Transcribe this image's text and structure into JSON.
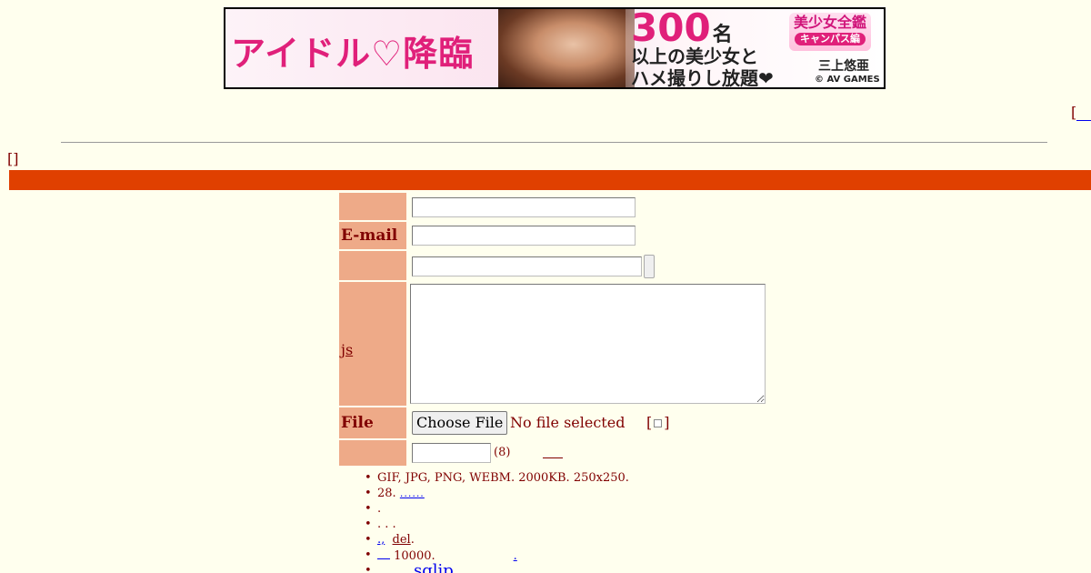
{
  "banner": {
    "title": "アイドル♡降臨",
    "big_number": "300",
    "big_number_unit": "名",
    "line2": "以上の美少女と",
    "line3": "ハメ撮りし放題❤",
    "logo": "美少女全鑑",
    "logo_sub": "キャンパス編",
    "name": "三上悠亜",
    "copyright": "© AV GAMES"
  },
  "nav_right": {
    "bracket_open": "["
  },
  "mode": {
    "bracket": "[]"
  },
  "form": {
    "email_label": "E-mail",
    "comment_label": "js",
    "file_label": "File",
    "file_button": "Choose File",
    "file_status": "No file selected",
    "textonly_open": "[",
    "textonly_close": "]",
    "delkey_hint": "(8)"
  },
  "rules": {
    "r1": "GIF, JPG, PNG, WEBM. 2000KB. 250x250.",
    "r2": "28.",
    "r2_link": "......",
    "r3": ".",
    "r4": ". . .",
    "r5_link": ".,",
    "r5_del": "del",
    "r5_end": ".",
    "r6": "10000.",
    "r6_link": ".",
    "r7_link": "sqlip"
  },
  "colors": {
    "background": "#ffffee",
    "text": "#800000",
    "mode_bar": "#e04000",
    "label_bg": "#eeaa88",
    "link": "#0000ee"
  }
}
